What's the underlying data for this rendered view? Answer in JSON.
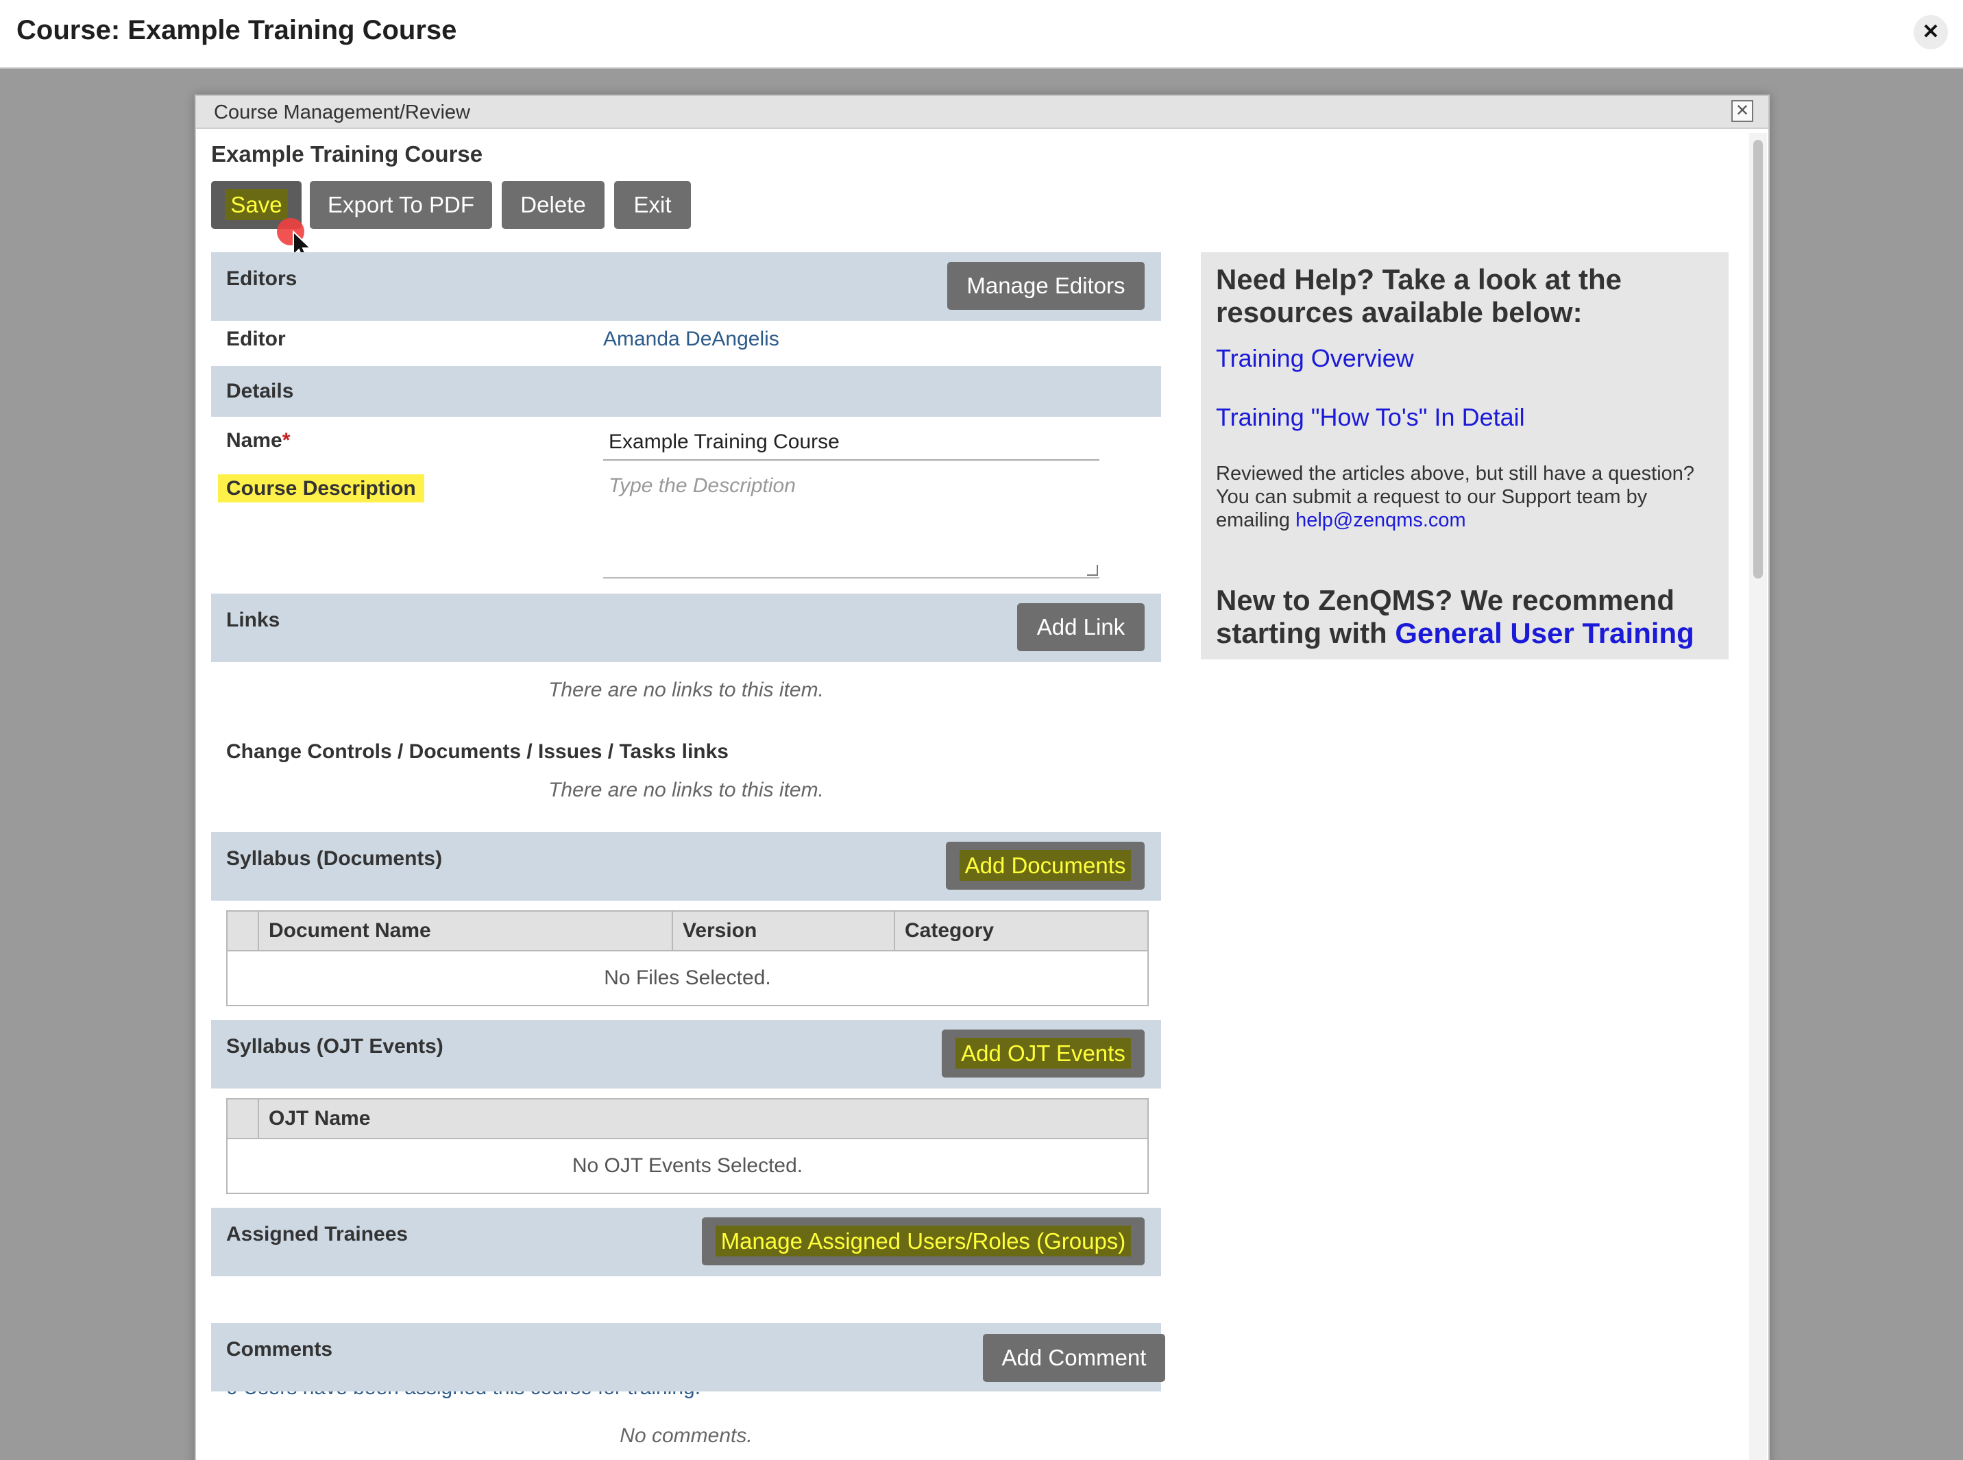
{
  "page": {
    "title": "Course: Example Training Course",
    "close_glyph": "✕"
  },
  "dialog": {
    "title": "Course Management/Review",
    "close_glyph": "✕",
    "course_title": "Example Training Course"
  },
  "toolbar": {
    "save": "Save",
    "export": "Export To PDF",
    "delete": "Delete",
    "exit": "Exit"
  },
  "editors": {
    "section": "Editors",
    "manage_button": "Manage Editors",
    "editor_label": "Editor",
    "editor_value": "Amanda DeAngelis"
  },
  "details": {
    "section": "Details",
    "name_label": "Name",
    "required_mark": "*",
    "name_value": "Example Training Course",
    "description_label": "Course Description",
    "description_placeholder": "Type the Description"
  },
  "links": {
    "section": "Links",
    "add_button": "Add Link",
    "empty": "There are no links to this item.",
    "cc_heading": "Change Controls / Documents / Issues / Tasks links",
    "cc_empty": "There are no links to this item."
  },
  "syllabus_docs": {
    "section": "Syllabus (Documents)",
    "add_button": "Add Documents",
    "columns": [
      "Document Name",
      "Version",
      "Category"
    ],
    "empty": "No Files Selected."
  },
  "syllabus_ojt": {
    "section": "Syllabus (OJT Events)",
    "add_button": "Add OJT Events",
    "columns": [
      "OJT Name"
    ],
    "empty": "No OJT Events Selected."
  },
  "trainees": {
    "section": "Assigned Trainees",
    "manage_button": "Manage Assigned Users/Roles (Groups)",
    "summary": "0 Users have been assigned this course for training."
  },
  "comments": {
    "section": "Comments",
    "add_button": "Add Comment",
    "empty": "No comments."
  },
  "help": {
    "heading": "Need Help? Take a look at the resources available below:",
    "link1": "Training Overview",
    "link2": "Training \"How To's\" In Detail",
    "text": "Reviewed the articles above, but still have a question? You can submit a request to our Support team by emailing",
    "email": "help@zenqms.com",
    "footer_text": "New to ZenQMS? We recommend starting with",
    "footer_link": "General User Training"
  },
  "colors": {
    "band": "#cdd8e3",
    "button": "#6e6e6e",
    "highlight_yellow": "#ffff3a",
    "link_blue": "#1a1ad8"
  }
}
